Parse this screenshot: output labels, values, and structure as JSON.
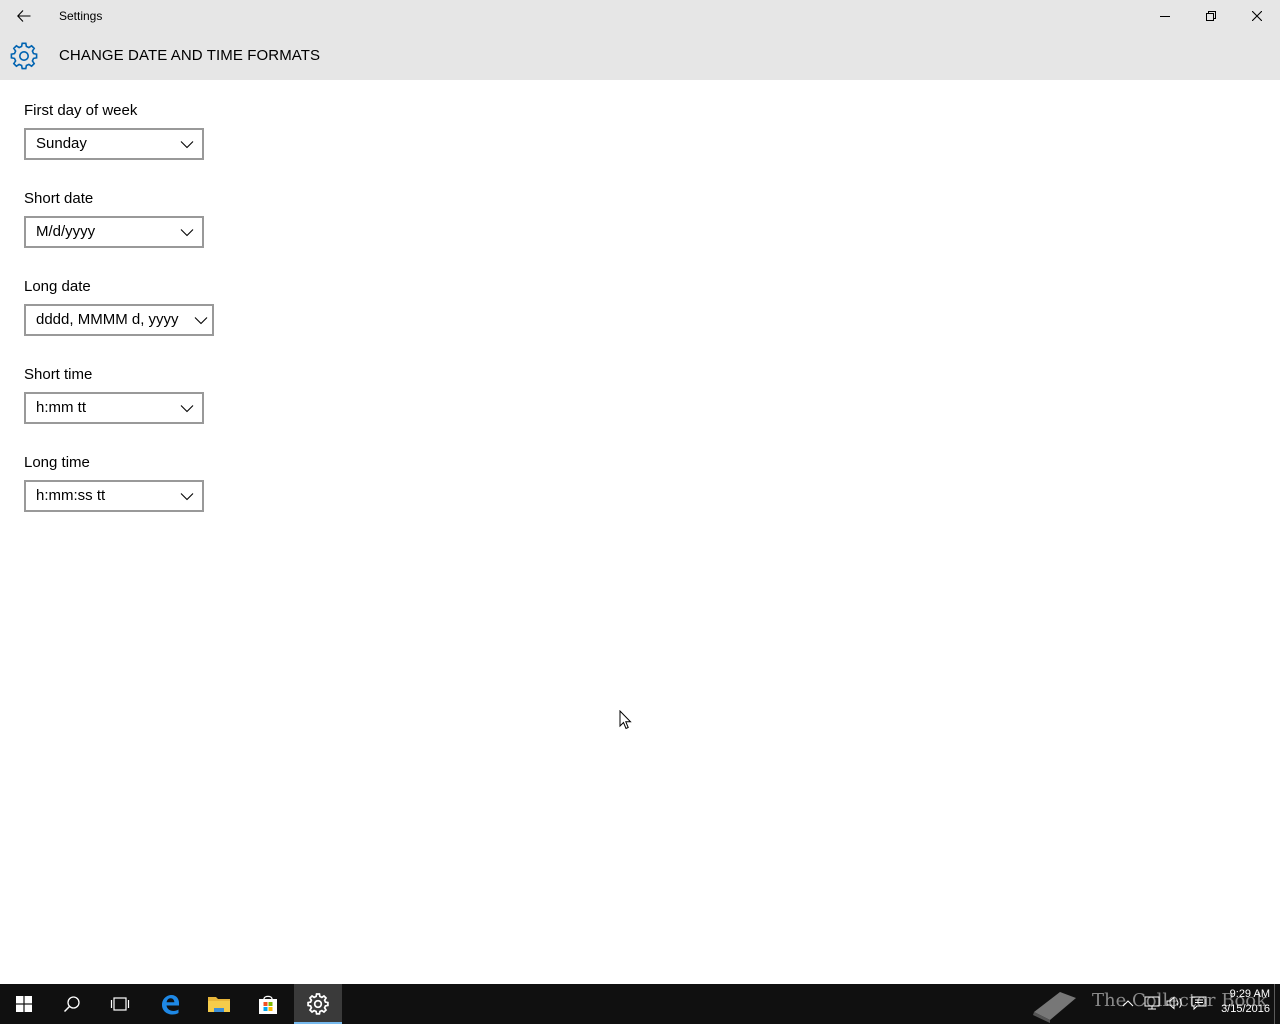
{
  "window": {
    "title": "Settings"
  },
  "header": {
    "title": "CHANGE DATE AND TIME FORMATS",
    "icon": "gear-icon",
    "accent_color": "#0063b1"
  },
  "fields": [
    {
      "label": "First day of week",
      "value": "Sunday"
    },
    {
      "label": "Short date",
      "value": "M/d/yyyy"
    },
    {
      "label": "Long date",
      "value": "dddd, MMMM d, yyyy"
    },
    {
      "label": "Short time",
      "value": "h:mm tt"
    },
    {
      "label": "Long time",
      "value": "h:mm:ss tt"
    }
  ],
  "taskbar": {
    "items": [
      "windows-start-icon",
      "search-icon",
      "task-view-icon",
      "edge-icon",
      "file-explorer-icon",
      "store-icon",
      "settings-icon"
    ],
    "active": "settings-icon",
    "watermark": "The Collector Book",
    "clock": {
      "time": "9:29 AM",
      "date": "3/15/2016"
    }
  }
}
